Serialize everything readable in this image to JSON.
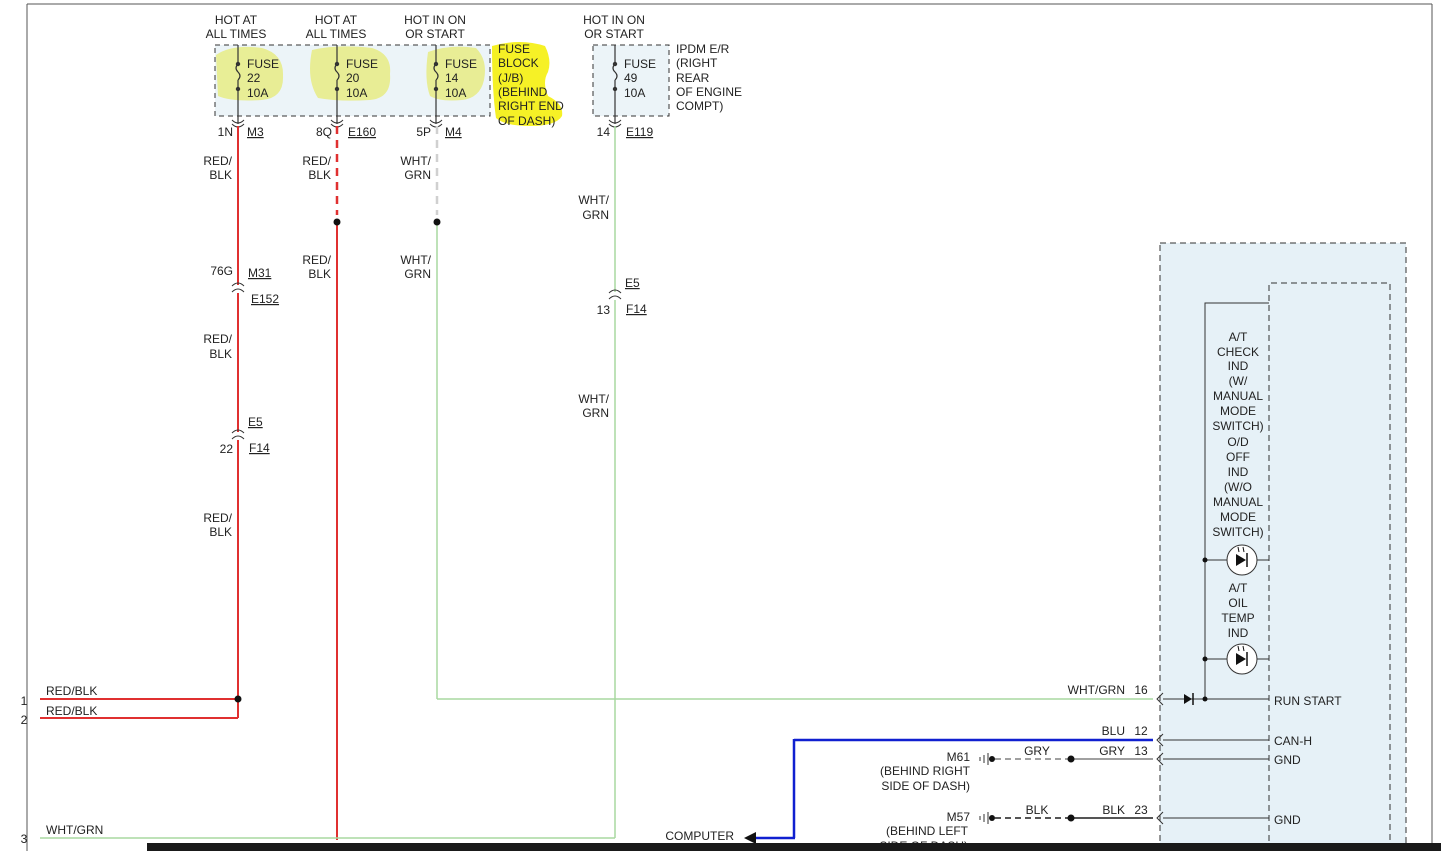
{
  "colors": {
    "red_wire": "#e03030",
    "green_wire": "#a8d8a0",
    "blue_wire": "#1020d0",
    "gray_wire": "#a0a0a0",
    "black_wire": "#555555",
    "highlight": "#f5f01a",
    "box_fill": "#dcebf3"
  },
  "supplies": [
    {
      "line1": "HOT AT",
      "line2": "ALL TIMES",
      "fuse_label": "FUSE",
      "fuse_num": "22",
      "fuse_amps": "10A",
      "pin": "1N",
      "connector": "M3"
    },
    {
      "line1": "HOT AT",
      "line2": "ALL TIMES",
      "fuse_label": "FUSE",
      "fuse_num": "20",
      "fuse_amps": "10A",
      "pin": "8Q",
      "connector": "E160"
    },
    {
      "line1": "HOT IN ON",
      "line2": "OR START",
      "fuse_label": "FUSE",
      "fuse_num": "14",
      "fuse_amps": "10A",
      "pin": "5P",
      "connector": "M4"
    },
    {
      "line1": "HOT IN ON",
      "line2": "OR START",
      "fuse_label": "FUSE",
      "fuse_num": "49",
      "fuse_amps": "10A",
      "pin": "14",
      "connector": "E119"
    }
  ],
  "fuse_block_label": [
    "FUSE",
    "BLOCK",
    "(J/B)",
    "(BEHIND",
    "RIGHT END",
    "OF DASH)"
  ],
  "ipdm_label": [
    "IPDM E/R",
    "(RIGHT",
    "REAR",
    "OF ENGINE",
    "COMPT)"
  ],
  "wire_labels": {
    "red_blk": [
      "RED/",
      "BLK"
    ],
    "wht_grn": [
      "WHT/",
      "GRN"
    ]
  },
  "connectors": {
    "m31_pin": "76G",
    "m31": "M31",
    "e152": "E152",
    "e5_a": "E5",
    "e5_a_pin": "22",
    "f14_a": "F14",
    "e5_b": "E5",
    "e5_b_pin": "13",
    "f14_b": "F14"
  },
  "left_rows": [
    {
      "num": "1",
      "label": "RED/BLK"
    },
    {
      "num": "2",
      "label": "RED/BLK"
    },
    {
      "num": "3",
      "label": "WHT/GRN"
    }
  ],
  "module": {
    "ind1": [
      "A/T",
      "CHECK",
      "IND",
      "(W/",
      "MANUAL",
      "MODE",
      "SWITCH)",
      "O/D",
      "OFF",
      "IND",
      "(W/O",
      "MANUAL",
      "MODE",
      "SWITCH)"
    ],
    "ind2": [
      "A/T",
      "OIL",
      "TEMP",
      "IND"
    ],
    "pins": [
      {
        "wire": "WHT/GRN",
        "num": "16",
        "name": "RUN START"
      },
      {
        "wire": "BLU",
        "num": "12",
        "name": "CAN-H"
      },
      {
        "wire": "GRY",
        "num": "13",
        "name": "GND"
      },
      {
        "wire": "BLK",
        "num": "23",
        "name": "GND"
      }
    ]
  },
  "grounds": [
    {
      "id": "M61",
      "loc1": "(BEHIND RIGHT",
      "loc2": "SIDE OF DASH)",
      "wire": "GRY"
    },
    {
      "id": "M57",
      "loc1": "(BEHIND LEFT",
      "loc2": "SIDE OF DASH)",
      "wire": "BLK"
    }
  ],
  "computer_label": "COMPUTER"
}
